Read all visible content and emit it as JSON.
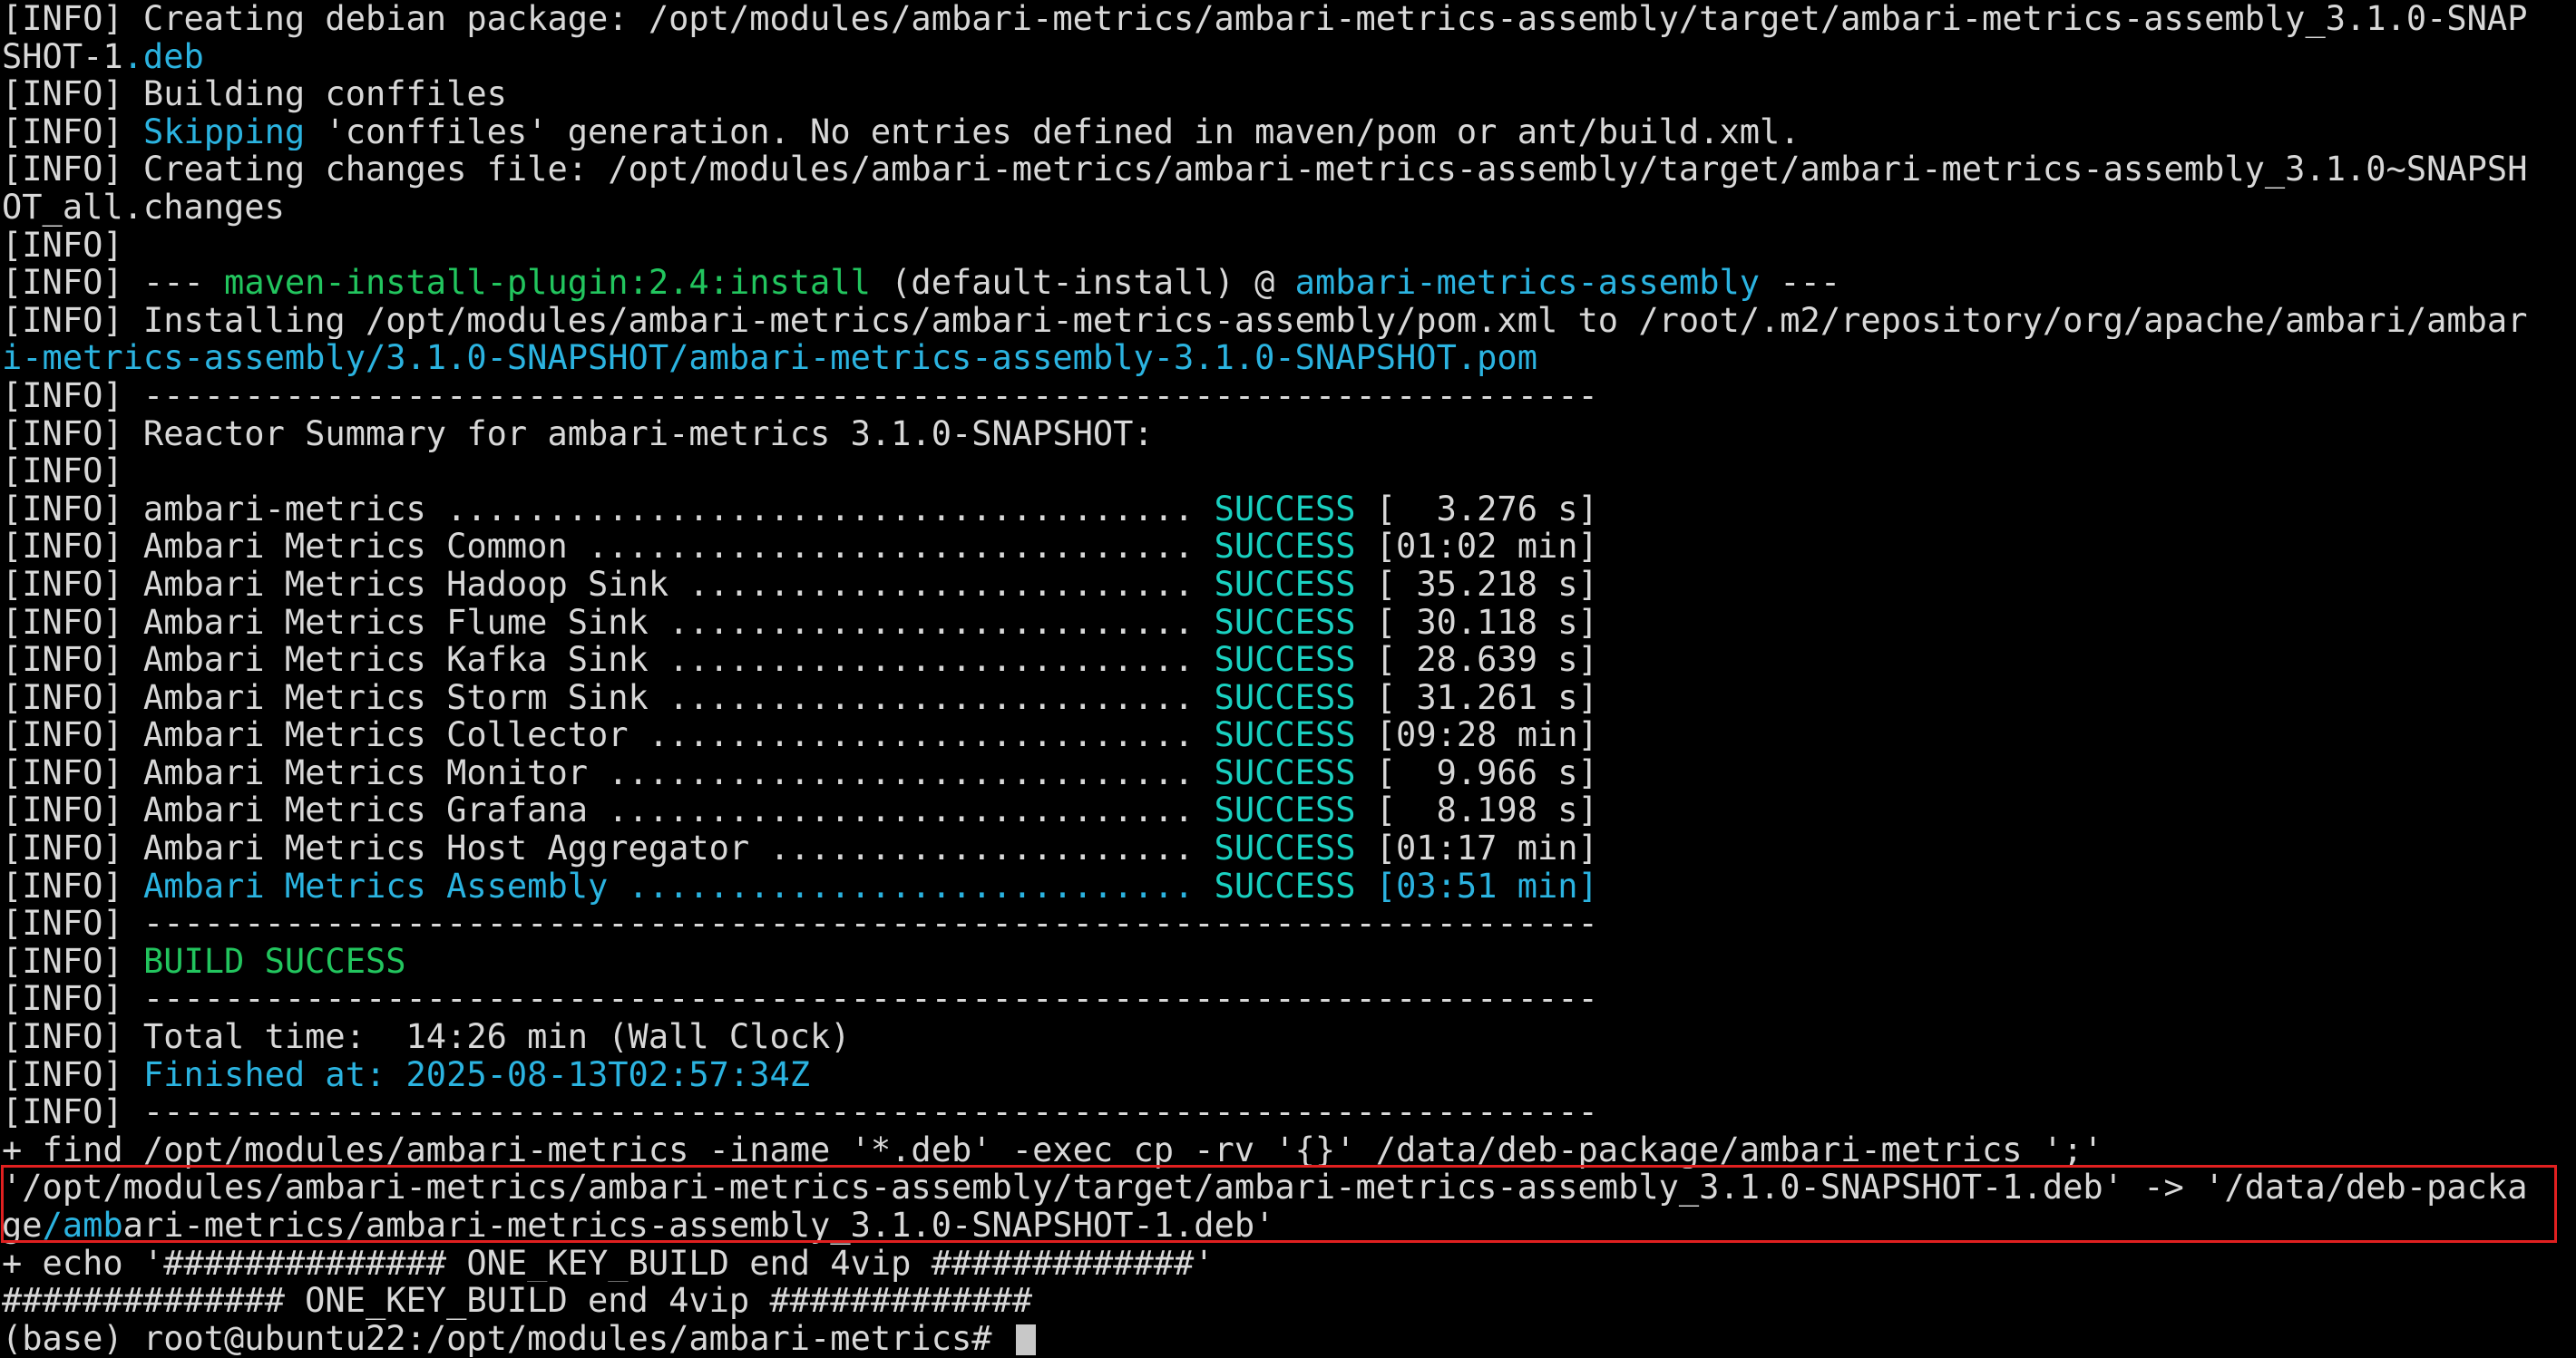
{
  "terminal": {
    "lines": [
      [
        {
          "t": "[INFO] Creating debian package: /opt/modules/ambari-metrics/ambari-metrics-assembly/target/ambari-metrics-assembly_3.1.0-SNAP"
        }
      ],
      [
        {
          "t": "SHOT-1"
        },
        {
          "t": ".deb",
          "c": "cyan"
        }
      ],
      [
        {
          "t": "[INFO] Building conffiles"
        }
      ],
      [
        {
          "t": "[INFO] "
        },
        {
          "t": "Skipping",
          "c": "cyan"
        },
        {
          "t": " 'conffiles' generation. No entries defined in maven/pom or ant/build.xml."
        }
      ],
      [
        {
          "t": "[INFO] Creating changes file: /opt/modules/ambari-metrics/ambari-metrics-assembly/target/ambari-metrics-assembly_3.1.0~SNAPSH"
        }
      ],
      [
        {
          "t": "OT_all.changes"
        }
      ],
      [
        {
          "t": "[INFO]"
        }
      ],
      [
        {
          "t": "[INFO] --- "
        },
        {
          "t": "maven-install-plugin:2.4:install",
          "c": "green"
        },
        {
          "t": " (default-install) @ "
        },
        {
          "t": "ambari-metrics-assembly",
          "c": "cyan"
        },
        {
          "t": " ---"
        }
      ],
      [
        {
          "t": "[INFO] Installing /opt/modules/ambari-metrics/ambari-metrics-assembly/pom.xml to /root/.m2/repository/org/apache/ambari/ambar"
        }
      ],
      [
        {
          "t": "i-metrics-assembly/3.1.0-SNAPSHOT/ambari-metrics-assembly-3.1.0-SNAPSHOT.pom",
          "c": "cyan"
        }
      ],
      [
        {
          "t": "[INFO] ------------------------------------------------------------------------"
        }
      ],
      [
        {
          "t": "[INFO] Reactor Summary for ambari-metrics 3.1.0-SNAPSHOT:"
        }
      ],
      [
        {
          "t": "[INFO]"
        }
      ],
      [
        {
          "t": "[INFO] ambari-metrics ..................................... "
        },
        {
          "t": "SUCCESS",
          "c": "succ"
        },
        {
          "t": " [  3.276 s]"
        }
      ],
      [
        {
          "t": "[INFO] Ambari Metrics Common .............................. "
        },
        {
          "t": "SUCCESS",
          "c": "succ"
        },
        {
          "t": " [01:02 min]"
        }
      ],
      [
        {
          "t": "[INFO] Ambari Metrics Hadoop Sink ......................... "
        },
        {
          "t": "SUCCESS",
          "c": "succ"
        },
        {
          "t": " [ 35.218 s]"
        }
      ],
      [
        {
          "t": "[INFO] Ambari Metrics Flume Sink .......................... "
        },
        {
          "t": "SUCCESS",
          "c": "succ"
        },
        {
          "t": " [ 30.118 s]"
        }
      ],
      [
        {
          "t": "[INFO] Ambari Metrics Kafka Sink .......................... "
        },
        {
          "t": "SUCCESS",
          "c": "succ"
        },
        {
          "t": " [ 28.639 s]"
        }
      ],
      [
        {
          "t": "[INFO] Ambari Metrics Storm Sink .......................... "
        },
        {
          "t": "SUCCESS",
          "c": "succ"
        },
        {
          "t": " [ 31.261 s]"
        }
      ],
      [
        {
          "t": "[INFO] Ambari Metrics Collector ........................... "
        },
        {
          "t": "SUCCESS",
          "c": "succ"
        },
        {
          "t": " [09:28 min]"
        }
      ],
      [
        {
          "t": "[INFO] Ambari Metrics Monitor ............................. "
        },
        {
          "t": "SUCCESS",
          "c": "succ"
        },
        {
          "t": " [  9.966 s]"
        }
      ],
      [
        {
          "t": "[INFO] Ambari Metrics Grafana ............................. "
        },
        {
          "t": "SUCCESS",
          "c": "succ"
        },
        {
          "t": " [  8.198 s]"
        }
      ],
      [
        {
          "t": "[INFO] Ambari Metrics Host Aggregator ..................... "
        },
        {
          "t": "SUCCESS",
          "c": "succ"
        },
        {
          "t": " [01:17 min]"
        }
      ],
      [
        {
          "t": "[INFO] "
        },
        {
          "t": "Ambari Metrics Assembly ............................",
          "c": "cyan"
        },
        {
          "t": " "
        },
        {
          "t": "SUCCESS",
          "c": "succ"
        },
        {
          "t": " [03:51 min]",
          "c": "cyan"
        }
      ],
      [
        {
          "t": "[INFO] ------------------------------------------------------------------------"
        }
      ],
      [
        {
          "t": "[INFO] "
        },
        {
          "t": "BUILD SUCCESS",
          "c": "green"
        }
      ],
      [
        {
          "t": "[INFO] ------------------------------------------------------------------------"
        }
      ],
      [
        {
          "t": "[INFO] Total time:  14:26 min (Wall Clock)"
        }
      ],
      [
        {
          "t": "[INFO] "
        },
        {
          "t": "Finished at: 2025-08-13T02:57:34Z",
          "c": "cyan"
        }
      ],
      [
        {
          "t": "[INFO] ------------------------------------------------------------------------"
        }
      ],
      [
        {
          "t": "+ find /opt/modules/ambari-metrics -iname '*.deb' -exec cp -rv '{}' /data/deb-package/ambari-metrics ';'"
        }
      ],
      [
        {
          "t": "'/opt/modules/ambari-metrics/ambari-metrics-assembly/target/ambari-metrics-assembly_3.1.0-SNAPSHOT-1.deb' -> '/data/deb-packa"
        }
      ],
      [
        {
          "t": "ge"
        },
        {
          "t": "/amb",
          "c": "cyan"
        },
        {
          "t": "ari-metrics/ambari-metrics-assembly_3.1.0-SNAPSHOT-1.deb'"
        }
      ],
      [
        {
          "t": "+ echo '############## ONE_KEY_BUILD end 4vip #############'"
        }
      ],
      [
        {
          "t": "############## ONE_KEY_BUILD end 4vip #############"
        }
      ],
      [
        {
          "t": "(base) root@ubuntu22:/opt/modules/ambari-metrics# "
        }
      ]
    ],
    "cursor_line": 35,
    "highlight_lines": [
      31,
      32
    ]
  },
  "colors": {
    "background": "#000000",
    "text": "#d8d8d8",
    "green": "#22c55e",
    "cyan": "#2bb3e0",
    "success": "#19d0c0",
    "highlight_border": "#e02020"
  }
}
